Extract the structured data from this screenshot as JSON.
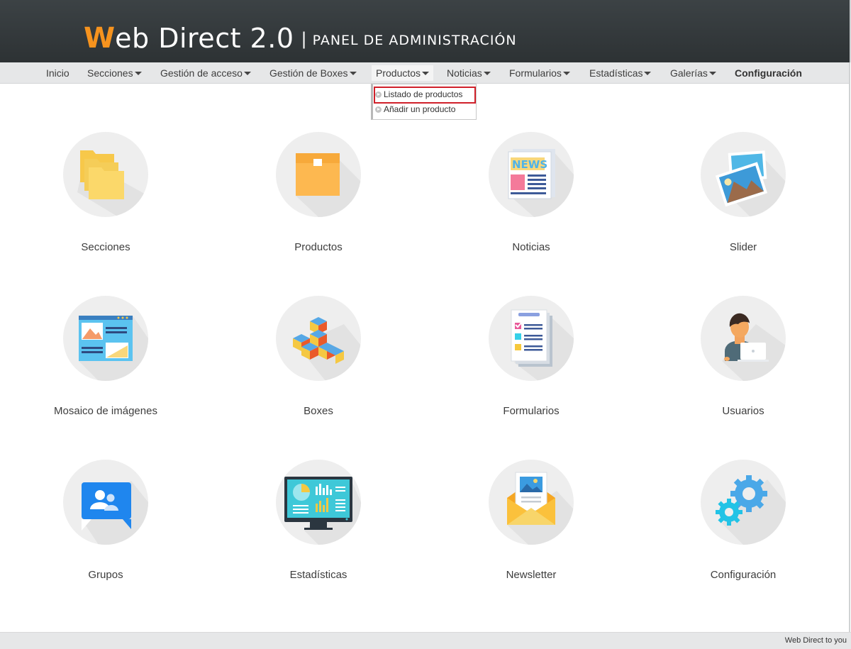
{
  "header": {
    "logo_initial": "W",
    "logo_rest": "eb Direct 2.0",
    "separator": "|",
    "subtitle": "PANEL DE ADMINISTRACIÓN",
    "accent_color": "#f6931e"
  },
  "nav": {
    "items": [
      {
        "label": "Inicio",
        "dropdown": false
      },
      {
        "label": "Secciones",
        "dropdown": true
      },
      {
        "label": "Gestión de acceso",
        "dropdown": true
      },
      {
        "label": "Gestión de Boxes",
        "dropdown": true
      },
      {
        "label": "Productos",
        "dropdown": true,
        "active": true
      },
      {
        "label": "Noticias",
        "dropdown": true
      },
      {
        "label": "Formularios",
        "dropdown": true
      },
      {
        "label": "Estadísticas",
        "dropdown": true
      },
      {
        "label": "Galerías",
        "dropdown": true
      },
      {
        "label": "Configuración",
        "dropdown": false,
        "bold": true
      }
    ]
  },
  "dropdown": {
    "items": [
      {
        "label": "Listado de productos",
        "highlighted": true
      },
      {
        "label": "Añadir un producto",
        "highlighted": false
      }
    ],
    "highlight_color": "#d0202a"
  },
  "tiles": [
    {
      "label": "Secciones",
      "icon": "folders-icon"
    },
    {
      "label": "Productos",
      "icon": "box-icon"
    },
    {
      "label": "Noticias",
      "icon": "newspaper-icon"
    },
    {
      "label": "Slider",
      "icon": "images-icon"
    },
    {
      "label": "Mosaico de imágenes",
      "icon": "mosaic-icon"
    },
    {
      "label": "Boxes",
      "icon": "cubes-icon"
    },
    {
      "label": "Formularios",
      "icon": "form-icon"
    },
    {
      "label": "Usuarios",
      "icon": "user-icon"
    },
    {
      "label": "Grupos",
      "icon": "group-icon"
    },
    {
      "label": "Estadísticas",
      "icon": "statistics-monitor-icon"
    },
    {
      "label": "Newsletter",
      "icon": "newsletter-envelope-icon"
    },
    {
      "label": "Configuración",
      "icon": "gears-icon"
    }
  ],
  "footer": {
    "text": "Web Direct to you"
  }
}
